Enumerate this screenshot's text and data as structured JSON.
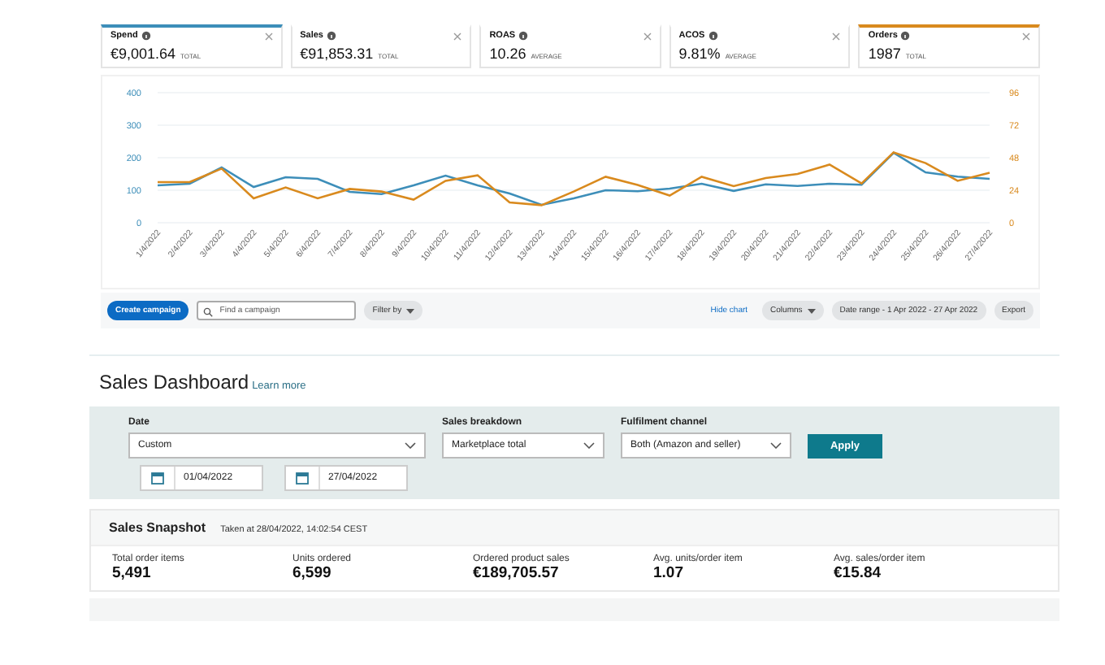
{
  "metrics": [
    {
      "label": "Spend",
      "value": "€9,001.64",
      "unit": "TOTAL",
      "selected": true,
      "color": "#3d8eb9"
    },
    {
      "label": "Sales",
      "value": "€91,853.31",
      "unit": "TOTAL",
      "selected": false
    },
    {
      "label": "ROAS",
      "value": "10.26",
      "unit": "AVERAGE",
      "selected": false
    },
    {
      "label": "ACOS",
      "value": "9.81%",
      "unit": "AVERAGE",
      "selected": false
    },
    {
      "label": "Orders",
      "value": "1987",
      "unit": "TOTAL",
      "selected": true,
      "color": "#d98a1e"
    }
  ],
  "chart_data": {
    "type": "line",
    "categories": [
      "1/4/2022",
      "2/4/2022",
      "3/4/2022",
      "4/4/2022",
      "5/4/2022",
      "6/4/2022",
      "7/4/2022",
      "8/4/2022",
      "9/4/2022",
      "10/4/2022",
      "11/4/2022",
      "12/4/2022",
      "13/4/2022",
      "14/4/2022",
      "15/4/2022",
      "16/4/2022",
      "17/4/2022",
      "18/4/2022",
      "19/4/2022",
      "20/4/2022",
      "21/4/2022",
      "22/4/2022",
      "23/4/2022",
      "24/4/2022",
      "25/4/2022",
      "26/4/2022",
      "27/4/2022"
    ],
    "grid": true,
    "ylim": [
      0,
      400
    ],
    "yticks": [
      0,
      100,
      200,
      300,
      400
    ],
    "y2lim": [
      0,
      96
    ],
    "y2ticks": [
      0,
      24,
      48,
      72,
      96
    ],
    "series": [
      {
        "color": "#3d8eb9",
        "values": [
          115,
          120,
          170,
          110,
          140,
          135,
          95,
          88,
          115,
          145,
          115,
          90,
          55,
          75,
          100,
          97,
          105,
          120,
          98,
          118,
          113,
          120,
          117,
          215,
          155,
          142,
          135
        ]
      },
      {
        "color": "#d98a1e",
        "axis": "y2",
        "values": [
          30,
          30,
          40,
          18,
          26,
          18,
          25,
          23,
          17,
          31,
          35,
          15,
          13,
          23,
          34,
          28,
          20,
          34,
          27,
          33,
          36,
          43,
          29,
          52,
          44,
          31,
          37
        ]
      }
    ]
  },
  "toolbar": {
    "create": "Create campaign",
    "search": {
      "placeholder": "Find a campaign"
    },
    "filter": "Filter by",
    "hide": "Hide chart",
    "columns": "Columns",
    "date_range": "Date range - 1 Apr 2022 - 27 Apr 2022",
    "export": "Export"
  },
  "dashboard": {
    "title": "Sales Dashboard",
    "learn_more": "Learn more",
    "filters": [
      {
        "label": "Date",
        "value": "Custom"
      },
      {
        "label": "Sales breakdown",
        "value": "Marketplace total"
      },
      {
        "label": "Fulfilment channel",
        "value": "Both (Amazon and seller)"
      }
    ],
    "from_date": "01/04/2022",
    "to_date": "27/04/2022",
    "apply": "Apply",
    "snapshot": {
      "title": "Sales Snapshot",
      "taken": "Taken at 28/04/2022, 14:02:54 CEST",
      "stats": [
        {
          "label": "Total order items",
          "value": "5,491"
        },
        {
          "label": "Units ordered",
          "value": "6,599"
        },
        {
          "label": "Ordered product sales",
          "value": "€189,705.57"
        },
        {
          "label": "Avg. units/order item",
          "value": "1.07"
        },
        {
          "label": "Avg. sales/order item",
          "value": "€15.84"
        }
      ]
    }
  }
}
